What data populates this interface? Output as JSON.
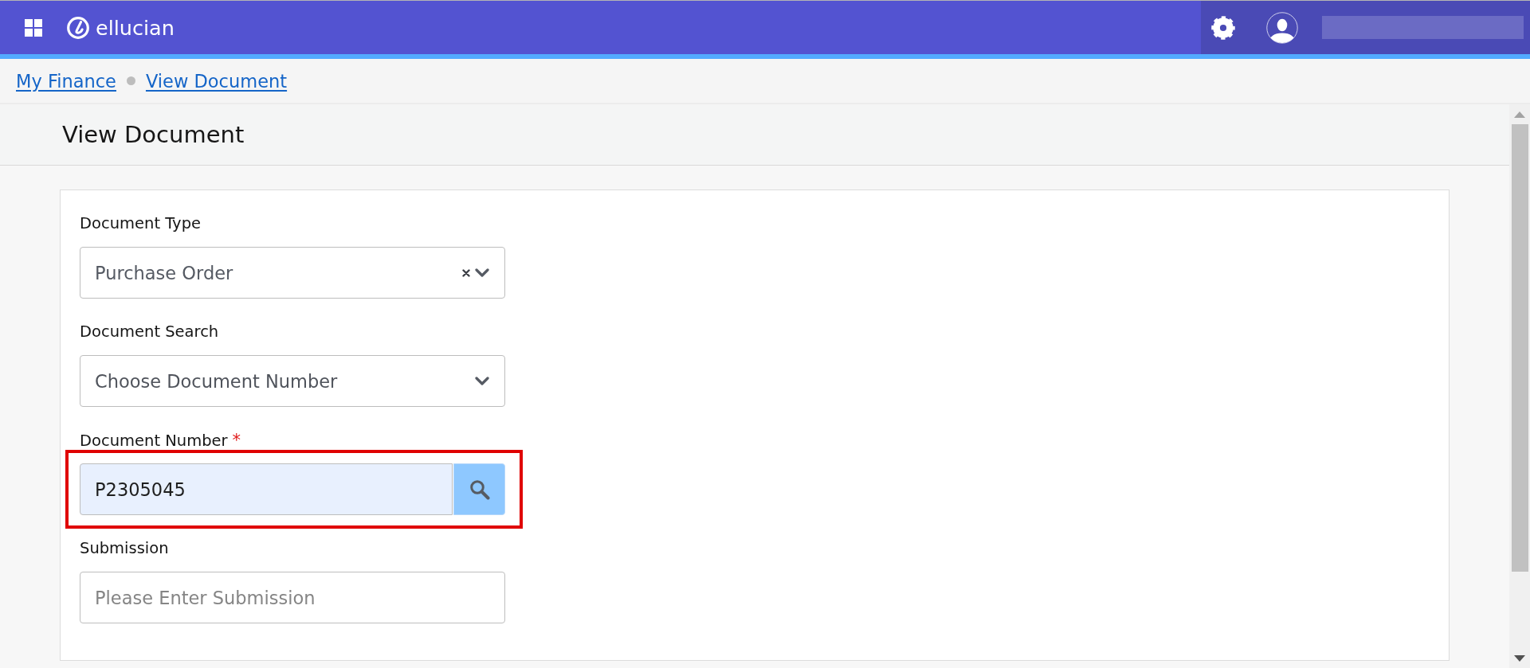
{
  "top_bar": {
    "brand": "ellucian"
  },
  "breadcrumb": [
    {
      "label": "My Finance"
    },
    {
      "label": "View Document"
    }
  ],
  "page": {
    "title": "View Document"
  },
  "form": {
    "fields": [
      {
        "kind": "select",
        "label": "Document Type",
        "value": "Purchase Order",
        "clearable": true,
        "highlighted": false
      },
      {
        "kind": "select",
        "label": "Document Search",
        "placeholder": "Choose Document Number",
        "clearable": false,
        "highlighted": false
      },
      {
        "kind": "search",
        "label": "Document Number",
        "required_mark": "*",
        "value": "P2305045",
        "highlighted": true
      },
      {
        "kind": "text",
        "label": "Submission",
        "placeholder": "Please Enter Submission",
        "highlighted": false
      }
    ]
  }
}
